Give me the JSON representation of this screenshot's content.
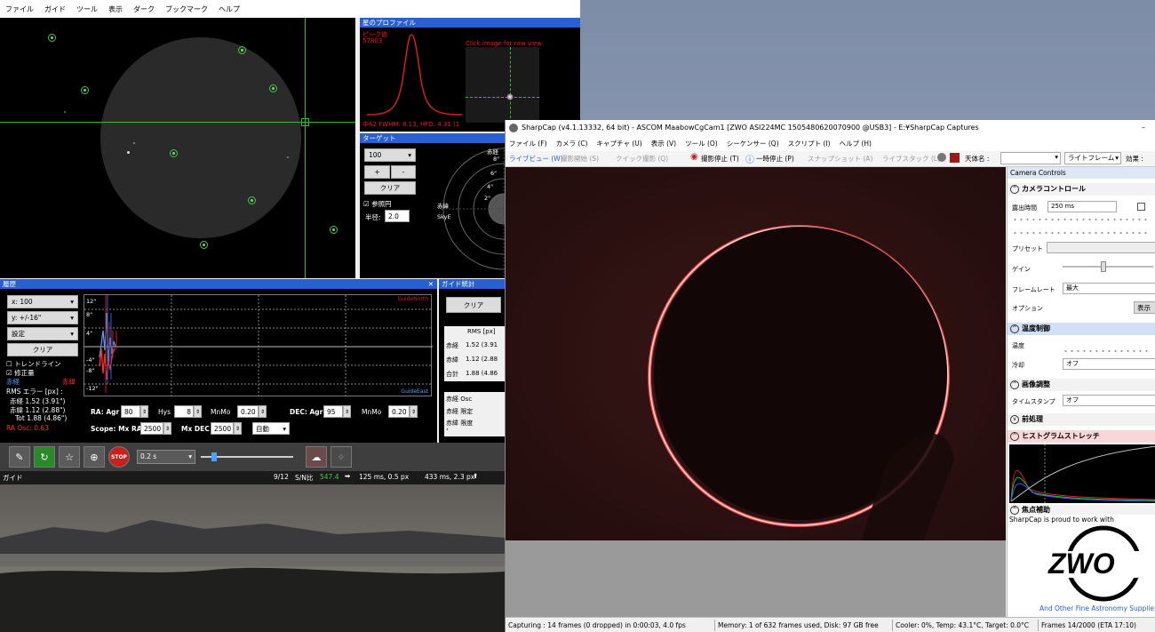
{
  "phd": {
    "menu": [
      "ファイル",
      "ガイド",
      "ツール",
      "表示",
      "ダーク",
      "ブックマーク",
      "ヘルプ"
    ],
    "profile": {
      "title": "星のプロファイル",
      "peak_label": "ピーク値",
      "peak_value": "57803",
      "click_hint": "Click image for raw view",
      "fwhm": "中62 FWHM: 8.13, HFD: 4.31 (1"
    },
    "target": {
      "title": "ターゲット",
      "zoom_value": "100",
      "plus": "+",
      "minus": "-",
      "clear": "クリア",
      "reference_circle": "参照円",
      "radius_label": "半径:",
      "radius_value": "2.0",
      "ra_label": "赤経",
      "dec_label": "赤緯",
      "skye_label": "SkyE",
      "rings": [
        "8\"",
        "6\"",
        "4\"",
        "2\""
      ]
    },
    "history": {
      "title": "履歴",
      "x_scale": "x: 100",
      "y_scale": "y: +/-16\"",
      "settings": "設定",
      "clear": "クリア",
      "trend": "トレンドライン",
      "correction": "修正量",
      "ra_legend": "赤経",
      "dec_legend": "赤緯",
      "rms_label": "RMS エラー [px] :",
      "rms_ra": "赤経 1.52 (3.91\")",
      "rms_dec": "赤緯 1.12 (2.88\")",
      "rms_tot": "Tot 1.88 (4.86\")",
      "ra_osc": "RA Osc: 0.63",
      "y_ticks": [
        "12\"",
        "8\"",
        "4\"",
        "-4\"",
        "-8\"",
        "-12\""
      ],
      "guide_north": "GuideNorth",
      "guide_east": "GuideEast",
      "ra_agr_label": "RA: Agr",
      "ra_agr": "80",
      "hys_label": "Hys",
      "hys": "8",
      "mnmo_label": "MnMo",
      "ra_mnmo": "0.20",
      "dec_agr_label": "DEC: Agr",
      "dec_agr": "95",
      "dec_mnmo": "0.20",
      "scope_label": "Scope: Mx RA",
      "mx_ra": "2500",
      "mx_dec_label": "Mx DEC",
      "mx_dec": "2500",
      "mode": "自動"
    },
    "guide_stats": {
      "title": "ガイド統計",
      "clear": "クリア",
      "rms_header": "RMS [px]",
      "rows": [
        {
          "label": "赤経",
          "value": "1.52 (3.91"
        },
        {
          "label": "赤緯",
          "value": "1.12 (2.88"
        },
        {
          "label": "合計",
          "value": "1.88 (4.86"
        }
      ],
      "osc_rows": [
        "赤経 Osc",
        "赤経 限定",
        "赤緯 限度"
      ]
    },
    "toolbar": {
      "exposure": "0.2 s"
    },
    "status": {
      "mode": "ガイド",
      "frames": "9/12",
      "snr_label": "S/N比",
      "snr_value": "547.4",
      "pulse1": "125 ms, 0.5 px",
      "pulse2": "433 ms, 2.3 px"
    }
  },
  "sharpcap": {
    "title": "SharpCap (v4.1.13332, 64 bit) - ASCOM MaabowCgCam1 [ZWO ASI224MC 1505480620070900 @USB3] - E:¥SharpCap Captures",
    "minimize": "–",
    "menu": [
      "ファイル (F)",
      "カメラ (C)",
      "キャプチャ (U)",
      "表示 (V)",
      "ツール (O)",
      "シーケンサー (Q)",
      "スクリプト (I)",
      "ヘルプ (H)"
    ],
    "toolbar": {
      "live_view": "ライブビュー (W)",
      "start_capture": "撮影開始 (S)",
      "quick_capture": "クイック撮影 (Q)",
      "stop_capture": "撮影停止 (T)",
      "pause": "一時停止 (P)",
      "snapshot": "スナップショット (A)",
      "live_stack": "ライブスタック (L)",
      "target_label": "天体名 :",
      "frame_type": "ライトフレーム",
      "effect_label": "効果 :"
    },
    "controls": {
      "header": "Camera Controls",
      "camera_section": "カメラコントロール",
      "exposure_label": "露出時間",
      "exposure_value": "250 ms",
      "preset_label": "プリセット",
      "gain_label": "ゲイン",
      "gain_level": 0.45,
      "framerate_label": "フレームレート",
      "framerate_value": "最大",
      "options_label": "オプション",
      "options_btn": "表示",
      "temp_section": "温度制御",
      "temp_label": "温度",
      "cooling_label": "冷却",
      "cooling_value": "オフ",
      "image_section": "画像調整",
      "timestamp_label": "タイムスタンプ",
      "timestamp_value": "オフ",
      "preprocess_section": "前処理",
      "histogram_section": "ヒストグラムストレッチ",
      "focus_section": "焦点補助",
      "proud": "SharpCap is proud to work with",
      "zwo_logo": "ZWO",
      "partners": "And Other Fine Astronomy Supplie"
    },
    "status": {
      "capturing": "Capturing : 14 frames (0 dropped) in 0:00:03, 4.0 fps",
      "memory": "Memory: 1 of 632 frames used, Disk: 97 GB free",
      "cooler": "Cooler: 0%, Temp: 43.1°C, Target: 0.0°C",
      "frames": "Frames 14/2000 (ETA 17:10)"
    }
  }
}
